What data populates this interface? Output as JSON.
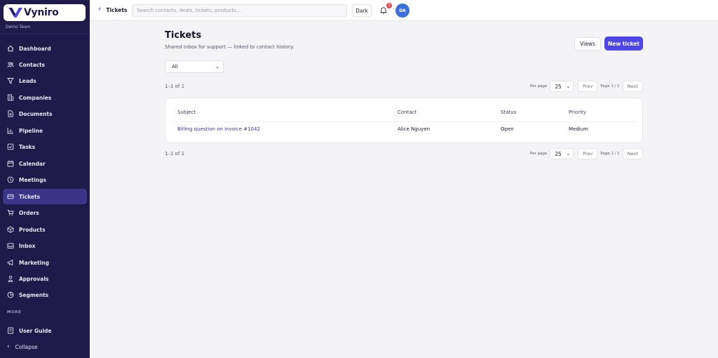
{
  "app": {
    "name": "Vyniro",
    "team": "Demo Team",
    "brand_color": "#1e1b4b",
    "accent_color": "#4f46e5"
  },
  "sidebar": {
    "items": [
      {
        "label": "Dashboard",
        "icon": "home-icon"
      },
      {
        "label": "Contacts",
        "icon": "contacts-icon"
      },
      {
        "label": "Leads",
        "icon": "filter-icon"
      },
      {
        "label": "Companies",
        "icon": "building-icon"
      },
      {
        "label": "Documents",
        "icon": "document-icon"
      },
      {
        "label": "Pipeline",
        "icon": "bar-chart-icon"
      },
      {
        "label": "Tasks",
        "icon": "checkbox-icon"
      },
      {
        "label": "Calendar",
        "icon": "calendar-icon"
      },
      {
        "label": "Meetings",
        "icon": "clock-icon"
      },
      {
        "label": "Tickets",
        "icon": "ticket-icon",
        "active": true
      },
      {
        "label": "Orders",
        "icon": "cart-icon"
      },
      {
        "label": "Products",
        "icon": "box-icon"
      },
      {
        "label": "Inbox",
        "icon": "inbox-icon"
      },
      {
        "label": "Marketing",
        "icon": "megaphone-icon"
      },
      {
        "label": "Approvals",
        "icon": "person-icon"
      },
      {
        "label": "Segments",
        "icon": "segments-icon"
      }
    ],
    "more_label": "MORE",
    "user_guide": "User Guide",
    "collapse": "Collapse"
  },
  "topbar": {
    "breadcrumb": "Tickets",
    "search_placeholder": "Search contacts, deals, tickets, products...",
    "theme_button": "Dark",
    "notification_count": "2",
    "avatar_initials": "DA"
  },
  "page": {
    "title": "Tickets",
    "subtitle": "Shared inbox for support — linked to contact history.",
    "views_button": "Views",
    "new_button": "New ticket",
    "filter_value": "All"
  },
  "pagination": {
    "count_text": "1–1 of 1",
    "per_page_label": "Per page",
    "per_page_value": "25",
    "prev": "Prev",
    "page_info": "Page 1 / 1",
    "next": "Next"
  },
  "table": {
    "columns": [
      "Subject",
      "Contact",
      "Status",
      "Priority"
    ],
    "rows": [
      {
        "subject": "Billing question on invoice #1042",
        "contact": "Alice Nguyen",
        "status": "Open",
        "priority": "Medium"
      }
    ]
  }
}
